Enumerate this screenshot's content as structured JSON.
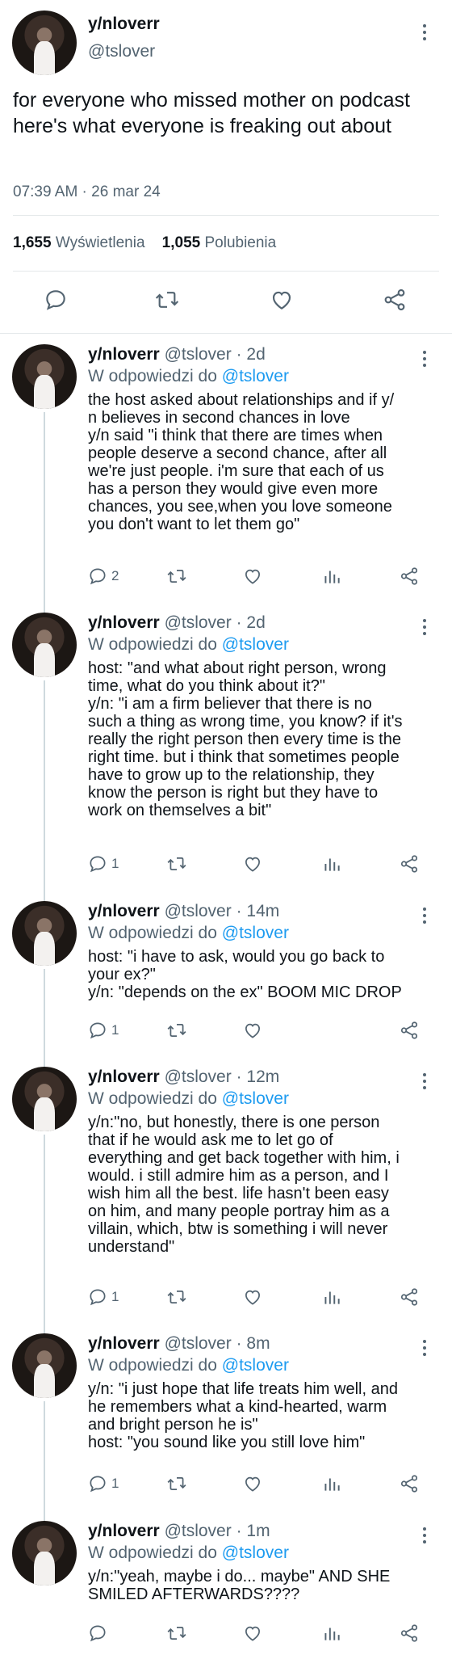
{
  "main_tweet": {
    "name": "y/nloverr",
    "handle": "@tslover",
    "text": "for everyone who missed mother on podcast here's what everyone is freaking out about",
    "time": "07:39 AM · 26 mar 24",
    "views_count": "1,655",
    "views_label": "Wyświetlenia",
    "likes_count": "1,055",
    "likes_label": "Polubienia",
    "icons": [
      "reply-icon",
      "retweet-icon",
      "like-icon",
      "share-icon"
    ]
  },
  "replies": [
    {
      "name": "y/nloverr",
      "meta": "@tslover · 2d",
      "reply_prefix": "W odpowiedzi do",
      "reply_to": "@tslover",
      "text": "the host asked about relationships and if y/\nn believes in second chances in love\ny/n said \"i think that there are times when\npeople deserve a second chance, after all\nwe're just people. i'm sure that each of us\nhas a person they would give even more\nchances, you see,when you love someone\nyou don't want to let them go\"",
      "reply_count": "2"
    },
    {
      "name": "y/nloverr",
      "meta": "@tslover · 2d",
      "reply_prefix": "W odpowiedzi do",
      "reply_to": "@tslover",
      "text": "host: \"and what about right person, wrong\ntime, what do you think about it?\"\ny/n: \"i am a firm believer that there is no\nsuch a thing as wrong time, you know? if it's\nreally the right person then every time is the\nright time. but i think that sometimes people\nhave to grow up to the relationship, they\nknow the person is right but they have to\nwork on themselves a bit\"",
      "reply_count": "1"
    },
    {
      "name": "y/nloverr",
      "meta": "@tslover · 14m",
      "reply_prefix": "W odpowiedzi do",
      "reply_to": "@tslover",
      "text": "host: \"i have to ask, would you go back to\nyour ex?\"\ny/n: \"depends on the ex\" BOOM MIC DROP",
      "reply_count": "1"
    },
    {
      "name": "y/nloverr",
      "meta": "@tslover · 12m",
      "reply_prefix": "W odpowiedzi do",
      "reply_to": "@tslover",
      "text": "y/n:\"no, but honestly, there is one person\nthat if he would ask me to let go of\neverything and get back together with him, i\nwould. i still admire him as a person, and I\nwish him all the best. life hasn't been easy\non him, and many people portray him as a\nvillain, which, btw is something i will never\nunderstand\"",
      "reply_count": "1"
    },
    {
      "name": "y/nloverr",
      "meta": "@tslover · 8m",
      "reply_prefix": "W odpowiedzi do",
      "reply_to": "@tslover",
      "text": "y/n: \"i just hope that life treats him well, and\nhe remembers what a kind-hearted, warm\nand  bright person he is\"\nhost: \"you sound like you still love him\"",
      "reply_count": "1"
    },
    {
      "name": "y/nloverr",
      "meta": "@tslover · 1m",
      "reply_prefix": "W odpowiedzi do",
      "reply_to": "@tslover",
      "text": "y/n:\"yeah, maybe i do... maybe\" AND SHE\nSMILED AFTERWARDS????",
      "reply_count": ""
    }
  ],
  "colors": {
    "link": "#1d9bf0",
    "secondary": "#536471",
    "text": "#0f1419",
    "border": "#e4e8ea"
  }
}
